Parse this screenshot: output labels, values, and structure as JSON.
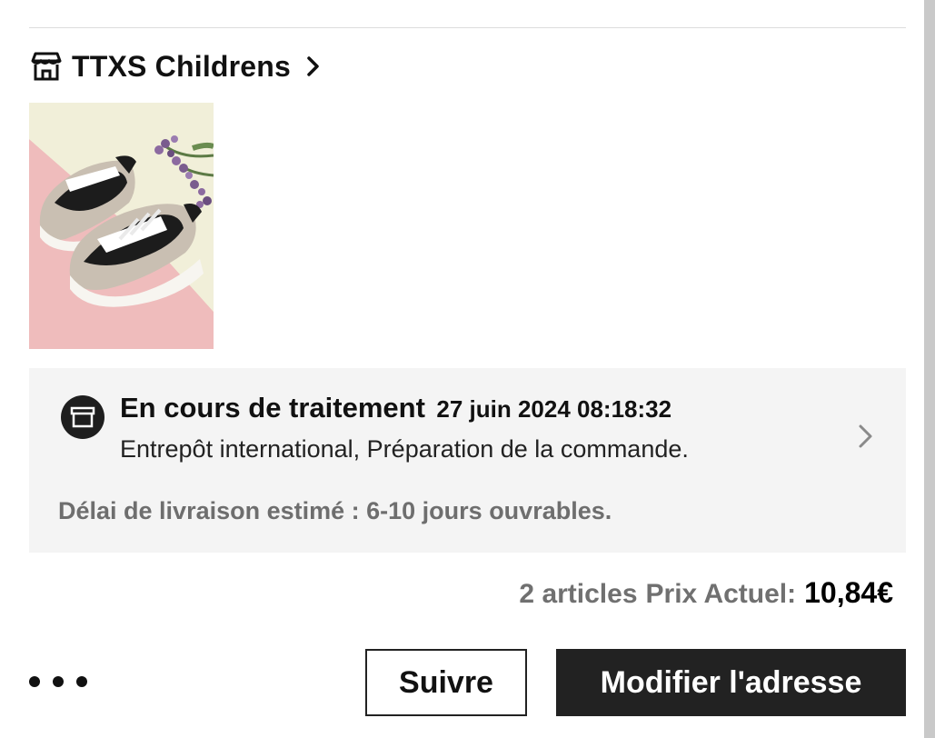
{
  "store": {
    "name": "TTXS Childrens",
    "icon": "store-icon"
  },
  "product": {
    "image_alt": "Children's sneakers product photo"
  },
  "status": {
    "title": "En cours de traitement",
    "time": "27 juin 2024 08:18:32",
    "description": "Entrepôt international, Préparation de la commande.",
    "delivery": "Délai de livraison estimé : 6-10 jours ouvrables.",
    "icon": "package-box-icon"
  },
  "summary": {
    "count": "2 articles",
    "label": "Prix Actuel:",
    "price": "10,84€"
  },
  "actions": {
    "follow_label": "Suivre",
    "change_address_label": "Modifier l'adresse"
  }
}
